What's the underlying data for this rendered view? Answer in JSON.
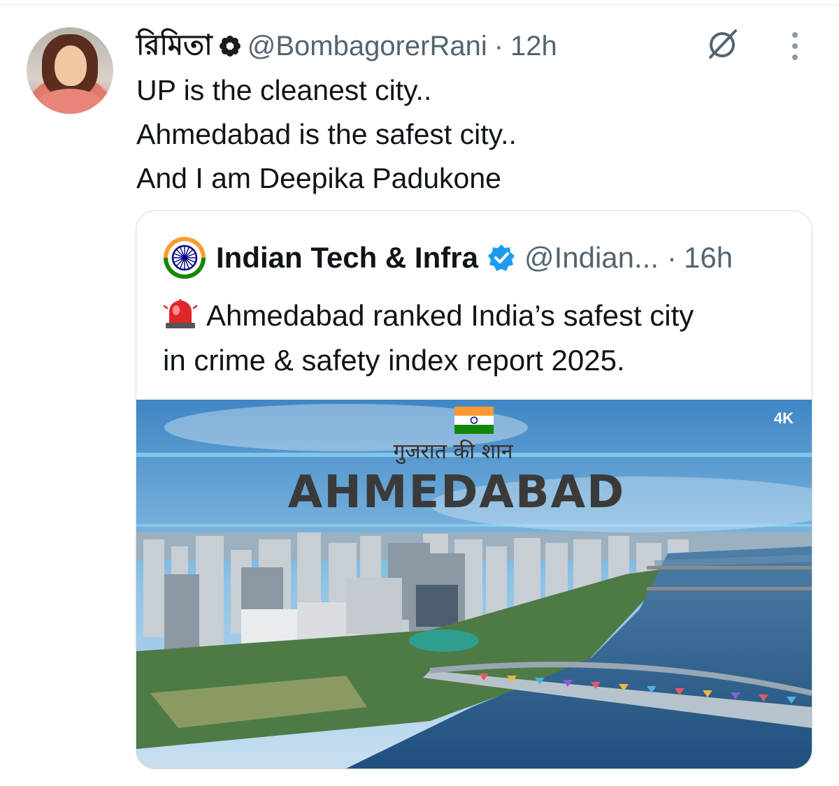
{
  "tweet": {
    "display_name": "রিমিতা",
    "handle": "@BombagorerRani",
    "separator": "·",
    "time": "12h",
    "lines": [
      "UP is the cleanest city..",
      "Ahmedabad is the safest city..",
      "And I am Deepika Padukone"
    ],
    "icons": {
      "badge": "flower-badge-icon",
      "grok": "grok-icon",
      "more": "more-options-icon"
    }
  },
  "quote": {
    "display_name": "Indian Tech & Infra",
    "handle": "@Indian...",
    "separator": "·",
    "time": "16h",
    "lines": [
      "Ahmedabad ranked India’s safest city",
      "in crime & safety index report 2025."
    ],
    "icons": {
      "avatar": "ashoka-chakra-icon",
      "verified": "verified-badge-icon",
      "emoji": "police-siren-icon"
    },
    "media": {
      "hindi_text": "गुजरात की शान",
      "title": "AHMEDABAD",
      "resolution_badge": "4K"
    }
  },
  "colors": {
    "text": "#0f1419",
    "secondary": "#536471",
    "border": "#cfd9de",
    "verified": "#1d9bf0"
  }
}
